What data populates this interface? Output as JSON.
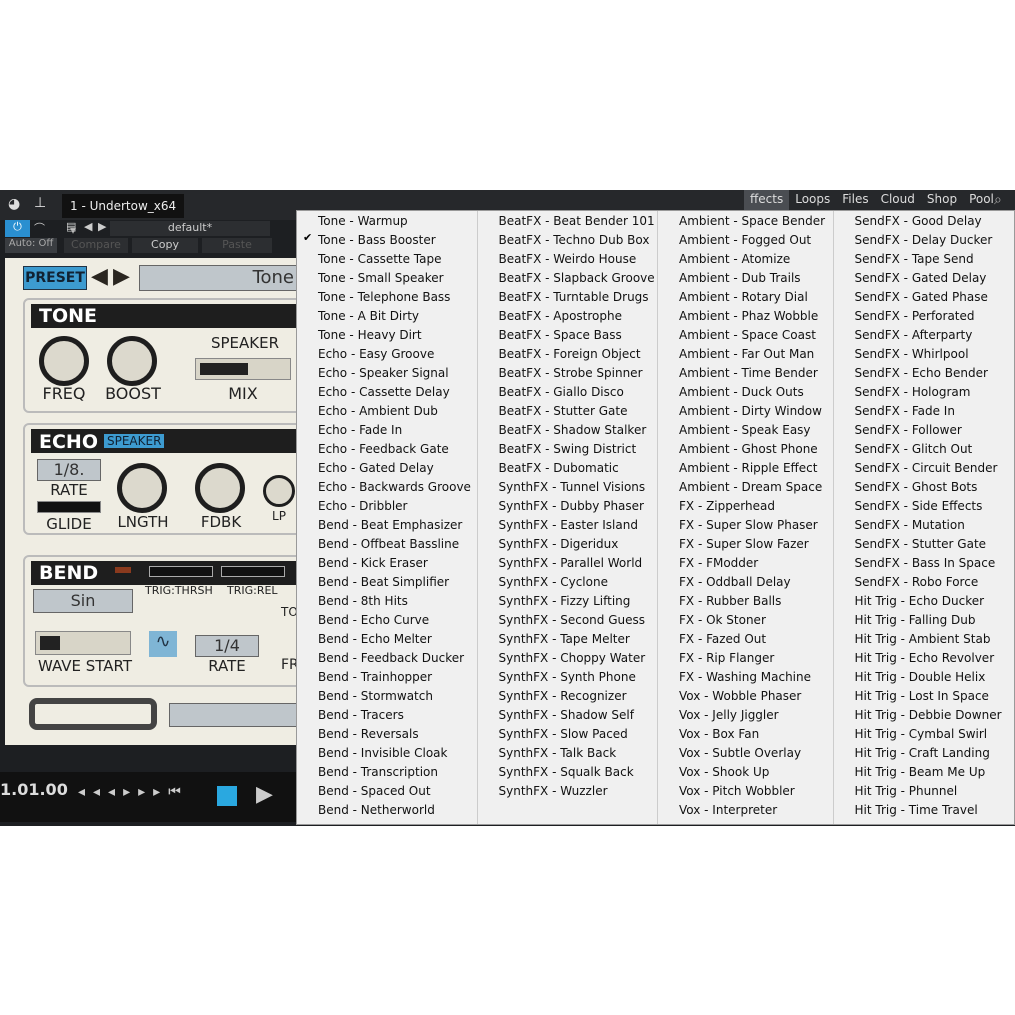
{
  "toolbar": {
    "title": "1 - Undertow_x64",
    "preset": "default*",
    "auto": "Auto: Off",
    "compare": "Compare",
    "copy": "Copy",
    "paste": "Paste"
  },
  "browser_tabs": [
    "ffects",
    "Loops",
    "Files",
    "Cloud",
    "Shop",
    "Pool"
  ],
  "plugin": {
    "preset_label": "PRESET",
    "preset_name": "Tone",
    "tone": {
      "title": "TONE",
      "freq": "FREQ",
      "boost": "BOOST",
      "speaker": "SPEAKER",
      "mix": "MIX"
    },
    "echo": {
      "title": "ECHO",
      "tag": "SPEAKER",
      "rate_value": "1/8.",
      "rate": "RATE",
      "glide": "GLIDE",
      "lngth": "LNGTH",
      "fdbk": "FDBK",
      "lp": "LP"
    },
    "bend": {
      "title": "BEND",
      "trig_thrsh": "TRIG:THRSH",
      "trig_rel": "TRIG:REL",
      "wave": "Sin",
      "wave_start": "WAVE START",
      "rate_value": "1/4",
      "rate": "RATE",
      "to": "TO",
      "fr": "FR"
    }
  },
  "transport": {
    "time": "1.01.00"
  },
  "menu": {
    "checked": "Tone - Bass Booster",
    "columns": [
      [
        "Tone - Warmup",
        "Tone - Bass Booster",
        "Tone - Cassette Tape",
        "Tone - Small Speaker",
        "Tone - Telephone Bass",
        "Tone - A Bit Dirty",
        "Tone - Heavy Dirt",
        "Echo - Easy Groove",
        "Echo - Speaker Signal",
        "Echo - Cassette Delay",
        "Echo - Ambient Dub",
        "Echo - Fade In",
        "Echo - Feedback Gate",
        "Echo - Gated Delay",
        "Echo - Backwards Groove",
        "Echo - Dribbler",
        "Bend - Beat Emphasizer",
        "Bend - Offbeat Bassline",
        "Bend - Kick Eraser",
        "Bend - Beat Simplifier",
        "Bend - 8th Hits",
        "Bend - Echo Curve",
        "Bend - Echo Melter",
        "Bend - Feedback Ducker",
        "Bend - Trainhopper",
        "Bend - Stormwatch",
        "Bend - Tracers",
        "Bend - Reversals",
        "Bend - Invisible Cloak",
        "Bend - Transcription",
        "Bend - Spaced Out",
        "Bend - Netherworld"
      ],
      [
        "BeatFX - Beat Bender 101",
        "BeatFX - Techno Dub Box",
        "BeatFX - Weirdo House",
        "BeatFX - Slapback Groove",
        "BeatFX - Turntable Drugs",
        "BeatFX - Apostrophe",
        "BeatFX - Space Bass",
        "BeatFX - Foreign Object",
        "BeatFX - Strobe Spinner",
        "BeatFX - Giallo Disco",
        "BeatFX - Stutter Gate",
        "BeatFX - Shadow Stalker",
        "BeatFX - Swing District",
        "BeatFX - Dubomatic",
        "SynthFX - Tunnel Visions",
        "SynthFX - Dubby Phaser",
        "SynthFX - Easter Island",
        "SynthFX - Digeridux",
        "SynthFX - Parallel World",
        "SynthFX - Cyclone",
        "SynthFX - Fizzy Lifting",
        "SynthFX - Second Guess",
        "SynthFX - Tape Melter",
        "SynthFX -  Choppy Water",
        "SynthFX - Synth Phone",
        "SynthFX - Recognizer",
        "SynthFX - Shadow Self",
        "SynthFX - Slow Paced",
        "SynthFX - Talk Back",
        "SynthFX - Squalk Back",
        "SynthFX - Wuzzler"
      ],
      [
        "Ambient - Space Bender",
        "Ambient - Fogged Out",
        "Ambient - Atomize",
        "Ambient - Dub Trails",
        "Ambient - Rotary Dial",
        "Ambient - Phaz Wobble",
        "Ambient - Space Coast",
        "Ambient - Far Out Man",
        "Ambient - Time Bender",
        "Ambient - Duck Outs",
        "Ambient - Dirty Window",
        "Ambient - Speak Easy",
        "Ambient - Ghost Phone",
        "Ambient - Ripple Effect",
        "Ambient - Dream Space",
        "FX - Zipperhead",
        "FX - Super Slow Phaser",
        "FX - Super Slow Fazer",
        "FX - FModder",
        "FX - Oddball Delay",
        "FX - Rubber Balls",
        "FX - Ok Stoner",
        "FX - Fazed Out",
        "FX - Rip Flanger",
        "FX - Washing Machine",
        "Vox - Wobble Phaser",
        "Vox - Jelly Jiggler",
        "Vox - Box Fan",
        "Vox - Subtle Overlay",
        "Vox - Shook Up",
        "Vox - Pitch Wobbler",
        "Vox - Interpreter"
      ],
      [
        "SendFX - Good Delay",
        "SendFX - Delay Ducker",
        "SendFX - Tape Send",
        "SendFX - Gated Delay",
        "SendFX - Gated Phase",
        "SendFX - Perforated",
        "SendFX - Afterparty",
        "SendFX - Whirlpool",
        "SendFX - Echo Bender",
        "SendFX - Hologram",
        "SendFX - Fade In",
        "SendFX - Follower",
        "SendFX - Glitch Out",
        "SendFX - Circuit Bender",
        "SendFX - Ghost Bots",
        "SendFX - Side Effects",
        "SendFX - Mutation",
        "SendFX - Stutter Gate",
        "SendFX - Bass In Space",
        "SendFX - Robo Force",
        "Hit Trig - Echo Ducker",
        "Hit Trig - Falling Dub",
        "Hit Trig - Ambient Stab",
        "Hit Trig - Echo Revolver",
        "Hit Trig - Double Helix",
        "Hit Trig - Lost In Space",
        "Hit Trig - Debbie Downer",
        "Hit Trig - Cymbal Swirl",
        "Hit Trig - Craft Landing",
        "Hit Trig - Beam Me Up",
        "Hit Trig - Phunnel",
        "Hit Trig - Time Travel"
      ]
    ]
  }
}
